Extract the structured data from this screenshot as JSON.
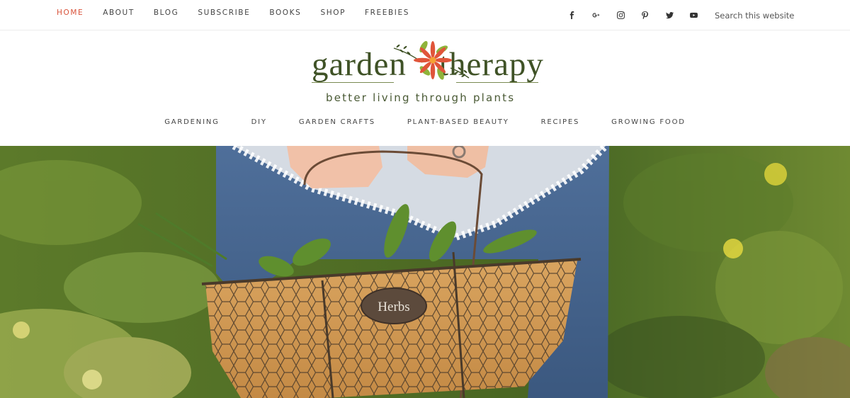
{
  "top_nav": {
    "items": [
      {
        "label": "HOME",
        "active": true
      },
      {
        "label": "ABOUT"
      },
      {
        "label": "BLOG"
      },
      {
        "label": "SUBSCRIBE"
      },
      {
        "label": "BOOKS"
      },
      {
        "label": "SHOP"
      },
      {
        "label": "FREEBIES"
      }
    ],
    "active_color": "#d9533b"
  },
  "social_icons": [
    "facebook-icon",
    "google-plus-icon",
    "instagram-icon",
    "pinterest-icon",
    "twitter-icon",
    "youtube-icon"
  ],
  "search": {
    "placeholder": "Search this website"
  },
  "logo": {
    "word_left": "garden",
    "word_right": "therapy",
    "tagline": "better living through plants"
  },
  "main_nav": {
    "items": [
      {
        "label": "GARDENING"
      },
      {
        "label": "DIY"
      },
      {
        "label": "GARDEN CRAFTS"
      },
      {
        "label": "PLANT-BASED BEAUTY"
      },
      {
        "label": "RECIPES"
      },
      {
        "label": "GROWING FOOD"
      }
    ]
  },
  "hero": {
    "basket_tag": "Herbs"
  },
  "colors": {
    "brand_green": "#3f5226",
    "accent_red": "#d9533b",
    "leaf_green": "#8fb33a"
  }
}
